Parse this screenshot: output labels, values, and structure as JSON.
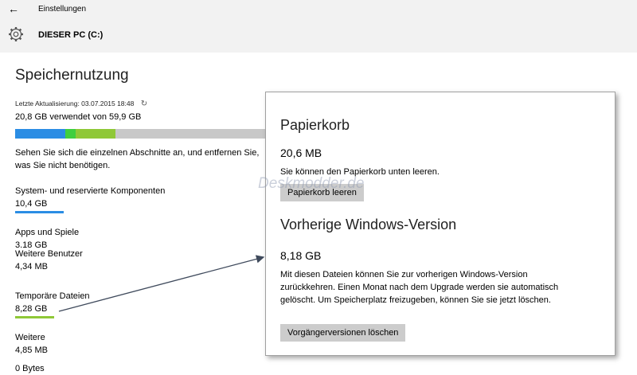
{
  "titlebar": {
    "back_glyph": "←",
    "title": "Einstellungen"
  },
  "header": {
    "icon": "gear-icon",
    "drive_name": "DIESER PC (C:)"
  },
  "storage": {
    "heading": "Speichernutzung",
    "last_update": "Letzte Aktualisierung: 03.07.2015 18:48",
    "refresh_icon": "refresh-icon",
    "used_text": "20,8 GB verwendet von 59,9 GB",
    "used_bar_colors": [
      "#2b8de4",
      "#3fcf3f",
      "#8fc837",
      "#c8c8c8"
    ],
    "description": "Sehen Sie sich die einzelnen Abschnitte an, und entfernen Sie, was Sie nicht benötigen."
  },
  "categories": [
    {
      "label": "System- und reservierte Komponenten",
      "size": "10,4 GB",
      "color": "#2b8de4"
    },
    {
      "label": "Apps und Spiele",
      "size": "3,18 GB",
      "color": ""
    },
    {
      "label": "Weitere Benutzer",
      "size": "4,34 MB",
      "color": ""
    },
    {
      "label": "Temporäre Dateien",
      "size": "8,28 GB",
      "color": "#8fc837"
    },
    {
      "label": "Weitere",
      "size": "4,85 MB",
      "color": ""
    },
    {
      "label": "0 Bytes",
      "size": "",
      "color": ""
    }
  ],
  "popup": {
    "recycle_heading": "Papierkorb",
    "recycle_size": "20,6 MB",
    "recycle_text": "Sie können den Papierkorb unten leeren.",
    "recycle_button": "Papierkorb leeren",
    "prev_heading": "Vorherige Windows-Version",
    "prev_size": "8,18 GB",
    "prev_text": "Mit diesen Dateien können Sie zur vorherigen Windows-Version zurückkehren. Einen Monat nach dem Upgrade werden sie automatisch gelöscht. Um Speicherplatz freizugeben, können Sie sie jetzt löschen.",
    "prev_button": "Vorgängerversionen löschen",
    "watermark": "Deskmodder.de"
  }
}
